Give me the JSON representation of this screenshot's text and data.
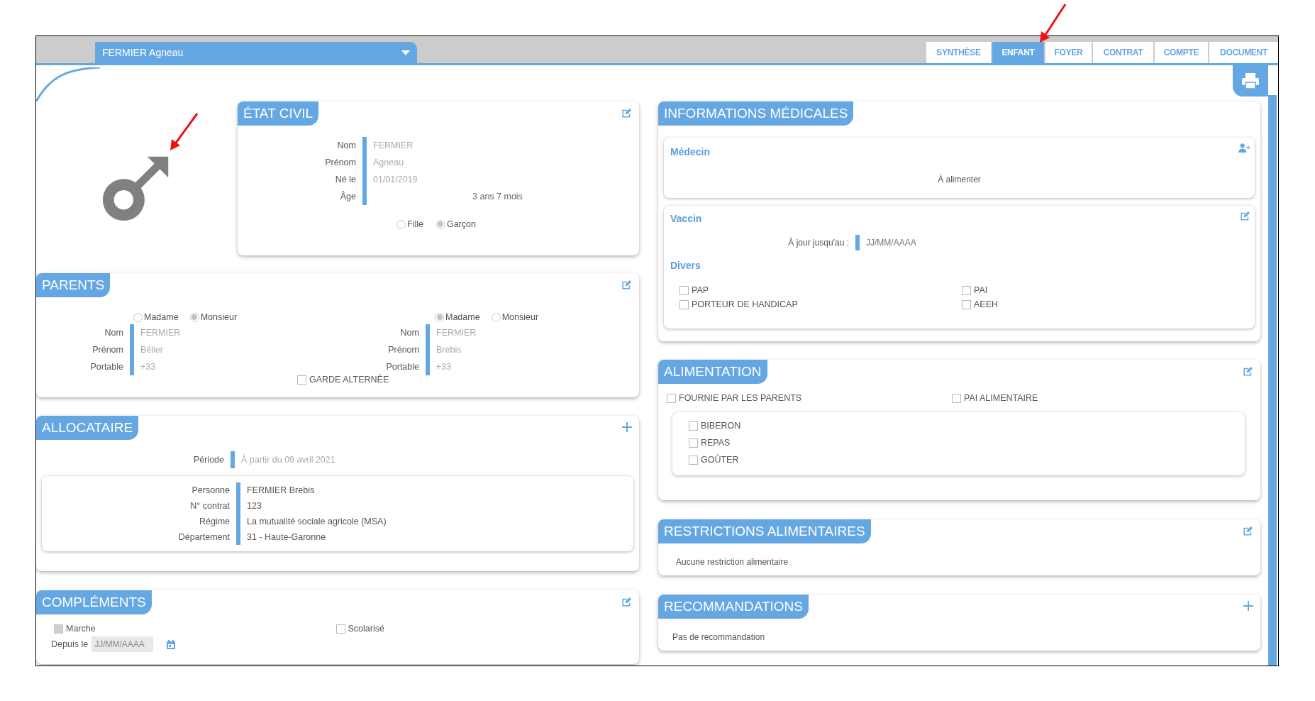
{
  "client_selector": {
    "value": "FERMIER Agneau"
  },
  "tabs": [
    {
      "label": "SYNTHÈSE",
      "selected": false
    },
    {
      "label": "ENFANT",
      "selected": true
    },
    {
      "label": "FOYER",
      "selected": false
    },
    {
      "label": "CONTRAT",
      "selected": false
    },
    {
      "label": "COMPTE",
      "selected": false
    },
    {
      "label": "DOCUMENT",
      "selected": false
    }
  ],
  "etat_civil": {
    "title": "ÉTAT CIVIL",
    "fields": [
      {
        "label": "Nom",
        "value": "FERMIER",
        "kind": "entry"
      },
      {
        "label": "Prénom",
        "value": "Agneau",
        "kind": "entry"
      },
      {
        "label": "Né le",
        "value": "01/01/2019",
        "kind": "entry"
      },
      {
        "label": "Âge",
        "value": "3 ans 7 mois",
        "kind": "computed"
      }
    ],
    "gender_options": [
      {
        "label": "Fille",
        "selected": false
      },
      {
        "label": "Garçon",
        "selected": true
      }
    ]
  },
  "parents": {
    "title": "PARENTS",
    "people": [
      {
        "civility_options": [
          {
            "label": "Madame",
            "selected": false
          },
          {
            "label": "Monsieur",
            "selected": true
          }
        ],
        "fields": [
          {
            "label": "Nom",
            "value": "FERMIER",
            "kind": "entry"
          },
          {
            "label": "Prénom",
            "value": "Bélier",
            "kind": "entry"
          },
          {
            "label": "Portable",
            "value": "+33",
            "kind": "entry"
          }
        ]
      },
      {
        "civility_options": [
          {
            "label": "Madame",
            "selected": true
          },
          {
            "label": "Monsieur",
            "selected": false
          }
        ],
        "fields": [
          {
            "label": "Nom",
            "value": "FERMIER",
            "kind": "entry"
          },
          {
            "label": "Prénom",
            "value": "Brebis",
            "kind": "entry"
          },
          {
            "label": "Portable",
            "value": "+33",
            "kind": "entry"
          }
        ]
      }
    ],
    "garde_alternee": {
      "label": "GARDE ALTERNÉE",
      "checked": false
    }
  },
  "allocataire": {
    "title": "ALLOCATAIRE",
    "periode": [
      {
        "label": "Période",
        "value": "À partir du 09 avril 2021",
        "kind": "entry"
      }
    ],
    "fields": [
      {
        "label": "Personne",
        "value": "FERMIER Brebis",
        "kind": "info"
      },
      {
        "label": "N° contrat",
        "value": "123",
        "kind": "info"
      },
      {
        "label": "Régime",
        "value": "La mutualité sociale agricole (MSA)",
        "kind": "info"
      },
      {
        "label": "Département",
        "value": "31 - Haute-Garonne",
        "kind": "info"
      }
    ]
  },
  "complements": {
    "title": "COMPLÉMENTS",
    "marche": {
      "label": "Marche",
      "checked": false,
      "disabled": true
    },
    "scolarise": {
      "label": "Scolarisé",
      "checked": false,
      "disabled": false
    },
    "depuis": {
      "label": "Depuis le",
      "placeholder": "JJ/MM/AAAA"
    }
  },
  "informations_medicales": {
    "title": "INFORMATIONS MÉDICALES",
    "medecin": {
      "title": "Médecin",
      "text": "À alimenter"
    },
    "vaccin": {
      "title": "Vaccin",
      "label": "À jour jusqu'au :",
      "placeholder": "JJ/MM/AAAA"
    },
    "divers": {
      "title": "Divers",
      "options": [
        {
          "label": "PAP",
          "checked": false
        },
        {
          "label": "PAI",
          "checked": false
        },
        {
          "label": "PORTEUR DE HANDICAP",
          "checked": false
        },
        {
          "label": "AEEH",
          "checked": false
        }
      ]
    }
  },
  "alimentation": {
    "title": "ALIMENTATION",
    "options": [
      {
        "label": "FOURNIE PAR LES PARENTS",
        "checked": false
      },
      {
        "label": "PAI ALIMENTAIRE",
        "checked": false
      }
    ],
    "meals": [
      {
        "label": "BIBERON",
        "checked": false
      },
      {
        "label": "REPAS",
        "checked": false
      },
      {
        "label": "GOÛTER",
        "checked": false
      }
    ]
  },
  "restrictions": {
    "title": "RESTRICTIONS ALIMENTAIRES",
    "text": "Aucune restriction alimentaire"
  },
  "recommandations": {
    "title": "RECOMMANDATIONS",
    "text": "Pas de recommandation"
  }
}
